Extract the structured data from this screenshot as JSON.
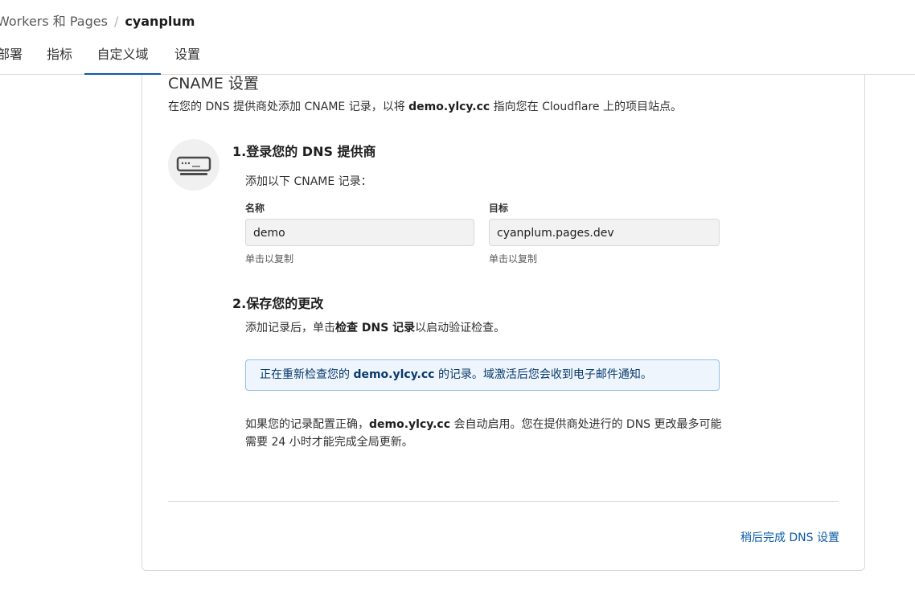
{
  "breadcrumb": {
    "parent": "Workers 和 Pages",
    "separator": "/",
    "current": "cyanplum"
  },
  "tabs": [
    {
      "label": "部署"
    },
    {
      "label": "指标"
    },
    {
      "label": "自定义域",
      "active": true
    },
    {
      "label": "设置"
    }
  ],
  "cname": {
    "title": "CNAME 设置",
    "desc_prefix": "在您的 DNS 提供商处添加 CNAME 记录，以将",
    "domain": "demo.ylcy.cc",
    "desc_suffix": "指向您在 Cloudflare 上的项目站点。"
  },
  "icon": "dns-server-icon",
  "step1": {
    "title": "1.登录您的 DNS 提供商",
    "subtitle": "添加以下 CNAME 记录："
  },
  "record": {
    "name_label": "名称",
    "name_value": "demo",
    "target_label": "目标",
    "target_value": "cyanplum.pages.dev",
    "copy_hint": "单击以复制"
  },
  "step2": {
    "title": "2.保存您的更改",
    "desc_prefix": "添加记录后，单击",
    "desc_bold": "检查 DNS 记录",
    "desc_suffix": "以启动验证检查。"
  },
  "info": {
    "prefix": "正在重新检查您的",
    "domain": "demo.ylcy.cc",
    "suffix": "的记录。域激活后您会收到电子邮件通知。"
  },
  "footnote": {
    "prefix": "如果您的记录配置正确，",
    "domain": "demo.ylcy.cc",
    "suffix": "会自动启用。您在提供商处进行的 DNS 更改最多可能需要 24 小时才能完成全局更新。"
  },
  "later_link": "稍后完成 DNS 设置",
  "colors": {
    "accent": "#0a5ba8",
    "info_bg": "#eef5fd",
    "info_border": "#92bfe8"
  }
}
